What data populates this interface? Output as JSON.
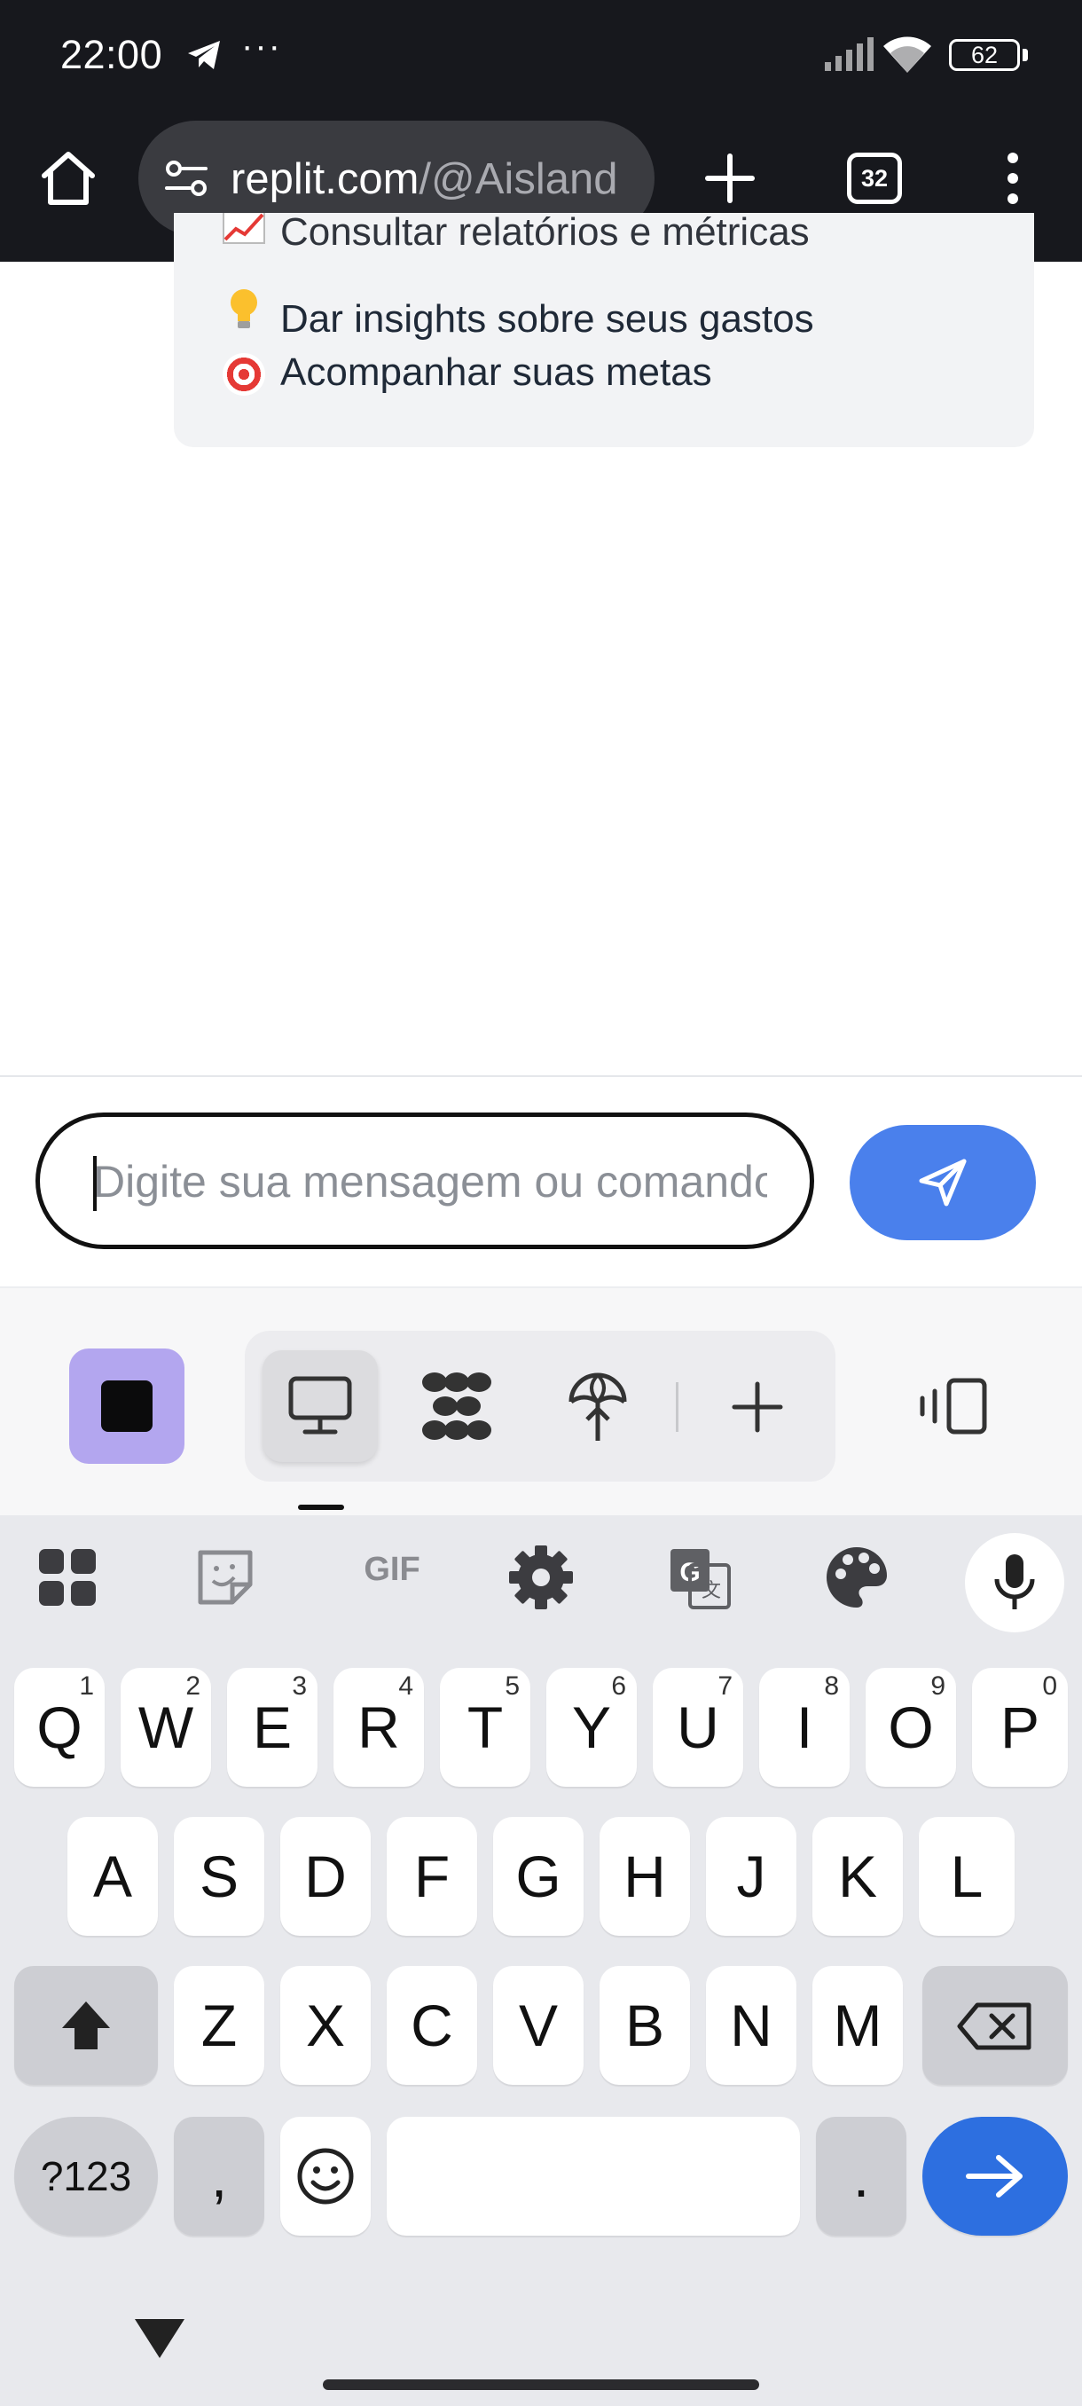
{
  "status_bar": {
    "time": "22:00",
    "dots": "···",
    "battery": "62"
  },
  "browser": {
    "url_host": "replit.com",
    "url_path": "/@Aisland",
    "tab_count": "32"
  },
  "chat": {
    "lines": [
      {
        "emoji": "📈",
        "text": "Consultar relatórios e métricas"
      },
      {
        "emoji": "💡",
        "text": "Dar insights sobre seus gastos"
      },
      {
        "emoji": "🎯",
        "text": "Acompanhar suas metas"
      }
    ],
    "input_placeholder": "Digite sua mensagem ou comando...",
    "input_value": ""
  },
  "keyboard": {
    "row1": [
      {
        "label": "Q",
        "hint": "1"
      },
      {
        "label": "W",
        "hint": "2"
      },
      {
        "label": "E",
        "hint": "3"
      },
      {
        "label": "R",
        "hint": "4"
      },
      {
        "label": "T",
        "hint": "5"
      },
      {
        "label": "Y",
        "hint": "6"
      },
      {
        "label": "U",
        "hint": "7"
      },
      {
        "label": "I",
        "hint": "8"
      },
      {
        "label": "O",
        "hint": "9"
      },
      {
        "label": "P",
        "hint": "0"
      }
    ],
    "row2": [
      "A",
      "S",
      "D",
      "F",
      "G",
      "H",
      "J",
      "K",
      "L"
    ],
    "row3": [
      "Z",
      "X",
      "C",
      "V",
      "B",
      "N",
      "M"
    ],
    "symbols_label": "?123",
    "comma_label": ",",
    "period_label": ".",
    "toolbar": [
      "apps-icon",
      "sticker-icon",
      "gif-icon",
      "settings-icon",
      "translate-icon",
      "palette-icon",
      "mic-icon"
    ],
    "gif_label": "GIF"
  },
  "colors": {
    "send_button": "#4a80ec",
    "stop_button": "#b3a6ef",
    "enter_key": "#2d6fe0"
  }
}
